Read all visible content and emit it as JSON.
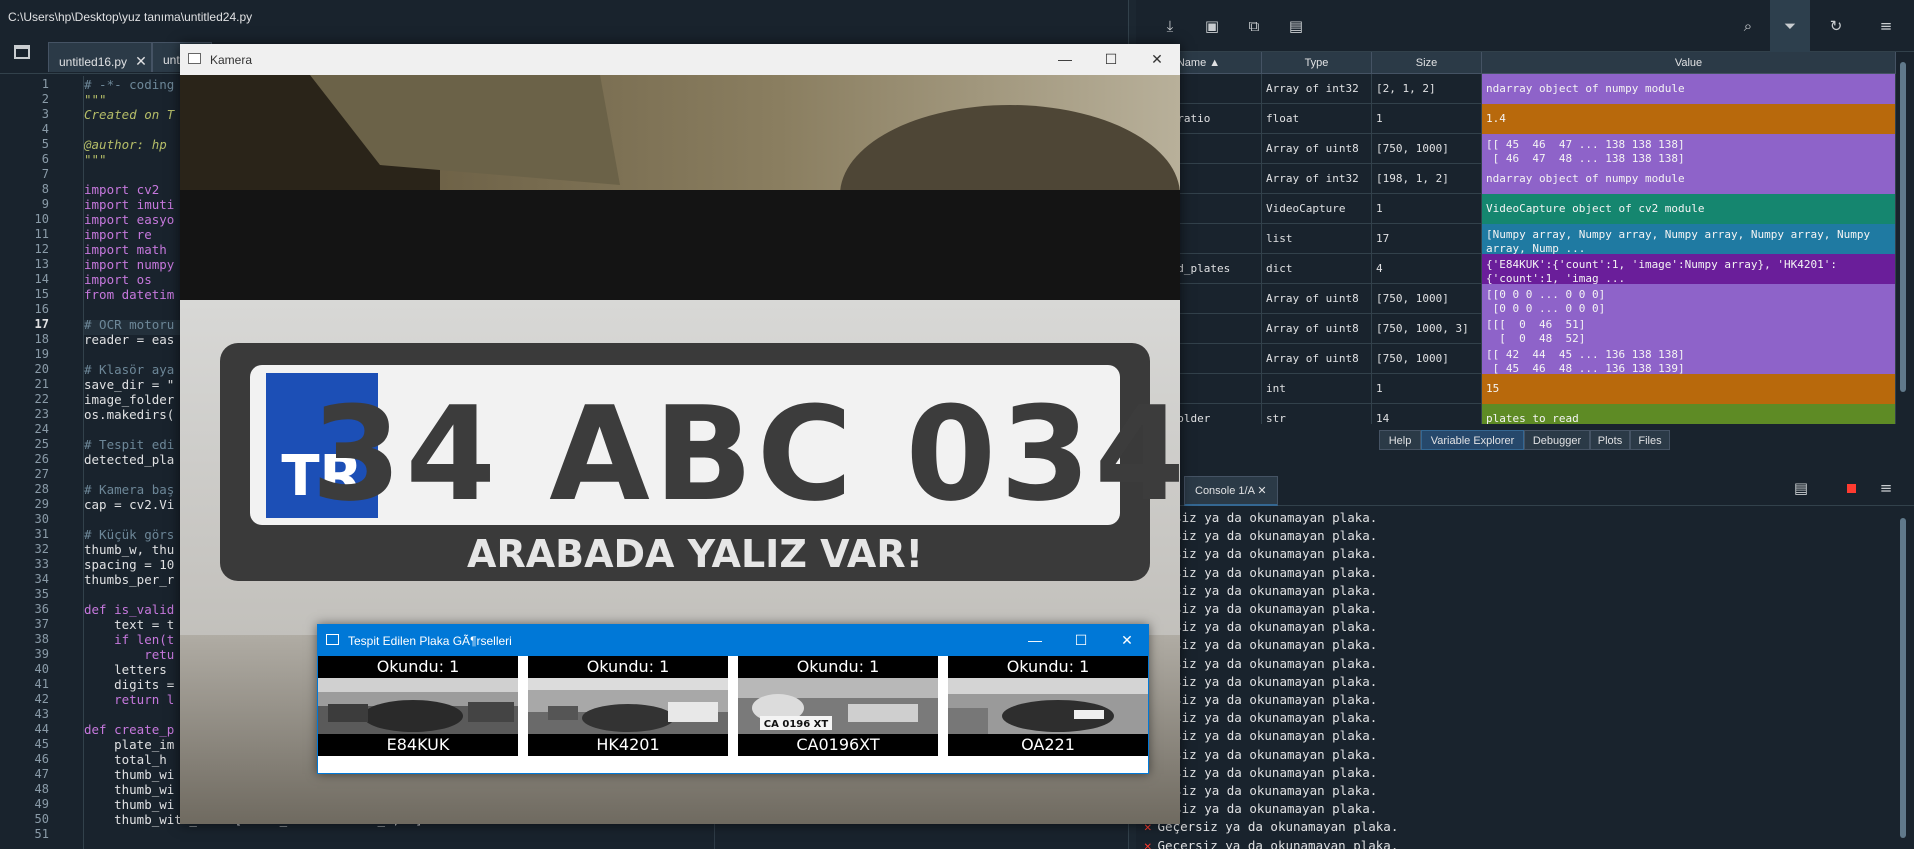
{
  "window": {
    "path": "C:\\Users\\hp\\Desktop\\yuz tanıma\\untitled24.py"
  },
  "editor": {
    "tabs": [
      "untitled16.py",
      "untit"
    ],
    "line_numbers": [
      "1",
      "2",
      "3",
      "4",
      "5",
      "6",
      "7",
      "8",
      "9",
      "10",
      "11",
      "12",
      "13",
      "14",
      "15",
      "16",
      "17",
      "18",
      "19",
      "20",
      "21",
      "22",
      "23",
      "24",
      "25",
      "26",
      "27",
      "28",
      "29",
      "30",
      "31",
      "32",
      "33",
      "34",
      "35",
      "36",
      "37",
      "38",
      "39",
      "40",
      "41",
      "42",
      "43",
      "44",
      "45",
      "46",
      "47",
      "48",
      "49",
      "50",
      "51"
    ],
    "code_lines": [
      {
        "text": "# -*- coding",
        "kind": "comment"
      },
      {
        "text": "\"\"\"",
        "kind": "str"
      },
      {
        "text": "Created on T",
        "kind": "str"
      },
      {
        "text": "",
        "kind": "plain"
      },
      {
        "text": "@author: hp",
        "kind": "str"
      },
      {
        "text": "\"\"\"",
        "kind": "str"
      },
      {
        "text": "",
        "kind": "plain"
      },
      {
        "text": "import cv2",
        "kind": "kw"
      },
      {
        "text": "import imuti",
        "kind": "kw"
      },
      {
        "text": "import easyo",
        "kind": "kw"
      },
      {
        "text": "import re",
        "kind": "kw"
      },
      {
        "text": "import math",
        "kind": "kw"
      },
      {
        "text": "import numpy",
        "kind": "kw"
      },
      {
        "text": "import os",
        "kind": "kw"
      },
      {
        "text": "from datetim",
        "kind": "kw"
      },
      {
        "text": "",
        "kind": "plain"
      },
      {
        "text": "# OCR motoru",
        "kind": "comment"
      },
      {
        "text": "reader = eas",
        "kind": "plain"
      },
      {
        "text": "",
        "kind": "plain"
      },
      {
        "text": "# Klasör aya",
        "kind": "comment"
      },
      {
        "text": "save_dir = \"",
        "kind": "plain"
      },
      {
        "text": "image_folder",
        "kind": "plain"
      },
      {
        "text": "os.makedirs(",
        "kind": "plain"
      },
      {
        "text": "",
        "kind": "plain"
      },
      {
        "text": "# Tespit edi",
        "kind": "comment"
      },
      {
        "text": "detected_pla",
        "kind": "plain"
      },
      {
        "text": "",
        "kind": "plain"
      },
      {
        "text": "# Kamera baş",
        "kind": "comment"
      },
      {
        "text": "cap = cv2.Vi",
        "kind": "plain"
      },
      {
        "text": "",
        "kind": "plain"
      },
      {
        "text": "# Küçük görs",
        "kind": "comment"
      },
      {
        "text": "thumb_w, thu",
        "kind": "plain"
      },
      {
        "text": "spacing = 10",
        "kind": "plain"
      },
      {
        "text": "thumbs_per_r",
        "kind": "plain"
      },
      {
        "text": "",
        "kind": "plain"
      },
      {
        "text": "def is_valid",
        "kind": "kw"
      },
      {
        "text": "    text = t",
        "kind": "plain"
      },
      {
        "text": "    if len(t",
        "kind": "kw"
      },
      {
        "text": "        retu",
        "kind": "kw"
      },
      {
        "text": "    letters ",
        "kind": "plain"
      },
      {
        "text": "    digits =",
        "kind": "plain"
      },
      {
        "text": "    return l",
        "kind": "kw"
      },
      {
        "text": "",
        "kind": "plain"
      },
      {
        "text": "def create_p",
        "kind": "kw"
      },
      {
        "text": "    plate_im",
        "kind": "plain"
      },
      {
        "text": "    total_h ",
        "kind": "plain"
      },
      {
        "text": "    thumb_wi",
        "kind": "plain"
      },
      {
        "text": "    thumb_wi",
        "kind": "plain"
      },
      {
        "text": "    thumb_wi",
        "kind": "plain"
      },
      {
        "text": "    thumb_with_texts[thumb_h + 20:total_h, :] = 0",
        "kind": "plain"
      },
      {
        "text": "",
        "kind": "plain"
      }
    ]
  },
  "variable_explorer": {
    "columns": [
      "Name",
      "Type",
      "Size",
      "Value"
    ],
    "rows": [
      {
        "name": "x",
        "type": "Array of int32",
        "size": "[2, 1, 2]",
        "value": "ndarray object of numpy module",
        "color": "#8e63c9"
      },
      {
        "name": "t_ratio",
        "type": "float",
        "size": "1",
        "value": "1.4",
        "color": "#b8690c"
      },
      {
        "name": "",
        "type": "Array of uint8",
        "size": "[750, 1000]",
        "value": "[[ 45  46  47 ... 138 138 138]\n [ 46  47  48 ... 138 138 138]",
        "color": "#8e63c9"
      },
      {
        "name": "",
        "type": "Array of int32",
        "size": "[198, 1, 2]",
        "value": "ndarray object of numpy module",
        "color": "#8e63c9"
      },
      {
        "name": "",
        "type": "VideoCapture",
        "size": "1",
        "value": "VideoCapture object of cv2 module",
        "color": "#15866f"
      },
      {
        "name": "",
        "type": "list",
        "size": "17",
        "value": "[Numpy array, Numpy array, Numpy array, Numpy array, Numpy\narray, Nump ...",
        "color": "#1f7aa2"
      },
      {
        "name": "ted_plates",
        "type": "dict",
        "size": "4",
        "value": "{'E84KUK':{'count':1, 'image':Numpy array}, 'HK4201':\n{'count':1, 'imag ...",
        "color": "#6a1e9a"
      },
      {
        "name": "",
        "type": "Array of uint8",
        "size": "[750, 1000]",
        "value": "[[0 0 0 ... 0 0 0]\n [0 0 0 ... 0 0 0]",
        "color": "#8e63c9"
      },
      {
        "name": "",
        "type": "Array of uint8",
        "size": "[750, 1000, 3]",
        "value": "[[[  0  46  51]\n  [  0  48  52]",
        "color": "#8e63c9"
      },
      {
        "name": "",
        "type": "Array of uint8",
        "size": "[750, 1000]",
        "value": "[[ 42  44  45 ... 136 138 138]\n [ 45  46  48 ... 136 138 139]",
        "color": "#8e63c9"
      },
      {
        "name": "",
        "type": "int",
        "size": "1",
        "value": "15",
        "color": "#b8690c"
      },
      {
        "name": "_folder",
        "type": "str",
        "size": "14",
        "value": "plates_to_read",
        "color": "#5e8b25"
      }
    ]
  },
  "pane_tabs": [
    "Help",
    "Variable Explorer",
    "Debugger",
    "Plots",
    "Files"
  ],
  "console": {
    "tab_label": "Console 1/A",
    "message": "Geçersiz ya da okunamayan plaka.",
    "lines": [
      "eçersiz ya da okunamayan plaka.",
      "eçersiz ya da okunamayan plaka.",
      "eçersiz ya da okunamayan plaka.",
      "eçersiz ya da okunamayan plaka.",
      "eçersiz ya da okunamayan plaka.",
      "eçersiz ya da okunamayan plaka.",
      "eçersiz ya da okunamayan plaka.",
      "eçersiz ya da okunamayan plaka.",
      "eçersiz ya da okunamayan plaka.",
      "eçersiz ya da okunamayan plaka.",
      "eçersiz ya da okunamayan plaka.",
      "eçersiz ya da okunamayan plaka.",
      "eçersiz ya da okunamayan plaka.",
      "eçersiz ya da okunamayan plaka.",
      "eçersiz ya da okunamayan plaka.",
      "eçersiz ya da okunamayan plaka.",
      "eçersiz ya da okunamayan plaka.",
      "Geçersiz ya da okunamayan plaka.",
      "Geçersiz ya da okunamayan plaka."
    ]
  },
  "camera_window": {
    "title": "Kamera",
    "plate_text": "34 ABC 034",
    "plate_country": "TR",
    "plate_slogan": "ARABADA YALIZ VAR!"
  },
  "plates_window": {
    "title": "Tespit Edilen Plaka GÃ¶rselleri",
    "thumbnails": [
      {
        "count_label": "Okundu: 1",
        "plate": "E84KUK",
        "photo_plate": ""
      },
      {
        "count_label": "Okundu: 1",
        "plate": "HK4201",
        "photo_plate": ""
      },
      {
        "count_label": "Okundu: 1",
        "plate": "CA0196XT",
        "photo_plate": "CA 0196 XT"
      },
      {
        "count_label": "Okundu: 1",
        "plate": "OA221",
        "photo_plate": ""
      }
    ]
  },
  "icons": {
    "toolbar": [
      "import-data-icon",
      "save-data-icon",
      "save-as-icon",
      "delete-icon",
      "search-icon",
      "filter-icon",
      "refresh-icon",
      "options-menu-icon"
    ],
    "accent": "#346792",
    "error": "#ff3b30"
  }
}
